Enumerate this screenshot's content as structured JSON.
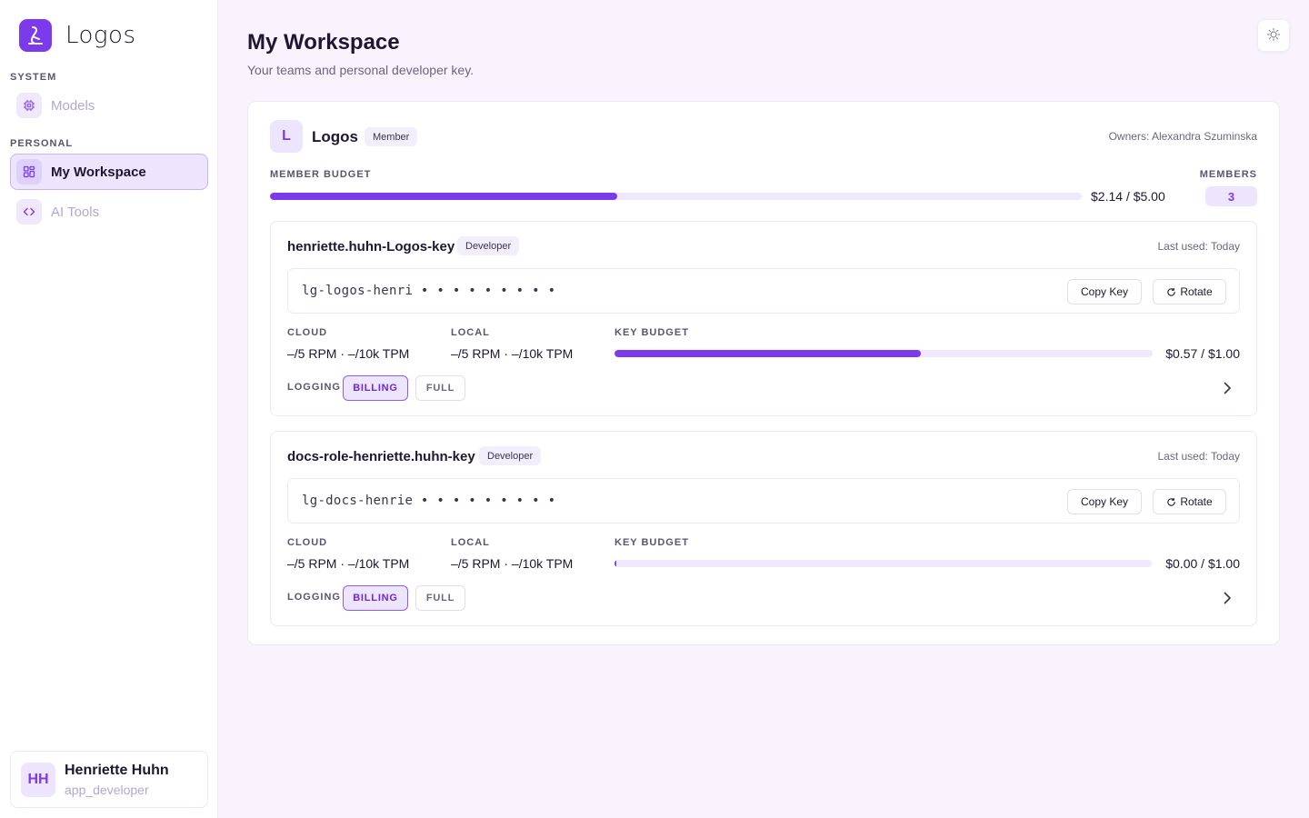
{
  "app": {
    "name": "Logos"
  },
  "sidebar": {
    "sections": [
      {
        "label": "SYSTEM",
        "items": [
          {
            "label": "Models",
            "icon": "chip-icon"
          }
        ]
      },
      {
        "label": "PERSONAL",
        "items": [
          {
            "label": "My Workspace",
            "icon": "grid-icon",
            "active": true
          },
          {
            "label": "AI Tools",
            "icon": "code-icon"
          }
        ]
      }
    ],
    "user": {
      "initials": "HH",
      "name": "Henriette Huhn",
      "role": "app_developer"
    }
  },
  "page": {
    "title": "My Workspace",
    "subtitle": "Your teams and personal developer key."
  },
  "team": {
    "initial": "L",
    "name": "Logos",
    "role_badge": "Member",
    "owners": "Owners: Alexandra Szuminska",
    "member_budget_label": "MEMBER BUDGET",
    "member_budget_text": "$2.14 / $5.00",
    "member_budget_fraction": 0.428,
    "members_label": "MEMBERS",
    "members_count": "3"
  },
  "keys": [
    {
      "name": "henriette.huhn-Logos-key",
      "badge": "Developer",
      "last_used": "Last used: Today",
      "value": "lg-logos-henri • • • • • • • • •",
      "copy_label": "Copy Key",
      "rotate_label": "Rotate",
      "cloud_label": "CLOUD",
      "cloud_value": "–/5 RPM · –/10k TPM",
      "local_label": "LOCAL",
      "local_value": "–/5 RPM · –/10k TPM",
      "budget_label": "KEY BUDGET",
      "budget_text": "$0.57 / $1.00",
      "budget_fraction": 0.57,
      "logging_label": "LOGGING",
      "logging_options": [
        "BILLING",
        "FULL"
      ],
      "logging_selected": "BILLING"
    },
    {
      "name": "docs-role-henriette.huhn-key",
      "badge": "Developer",
      "last_used": "Last used: Today",
      "value": "lg-docs-henrie • • • • • • • • •",
      "copy_label": "Copy Key",
      "rotate_label": "Rotate",
      "cloud_label": "CLOUD",
      "cloud_value": "–/5 RPM · –/10k TPM",
      "local_label": "LOCAL",
      "local_value": "–/5 RPM · –/10k TPM",
      "budget_label": "KEY BUDGET",
      "budget_text": "$0.00 / $1.00",
      "budget_fraction": 0.0,
      "logging_label": "LOGGING",
      "logging_options": [
        "BILLING",
        "FULL"
      ],
      "logging_selected": "BILLING"
    }
  ],
  "colors": {
    "accent": "#7c3aed",
    "accent_light": "#ede4fd",
    "background": "#f8f3fd",
    "text": "#1e1633"
  }
}
